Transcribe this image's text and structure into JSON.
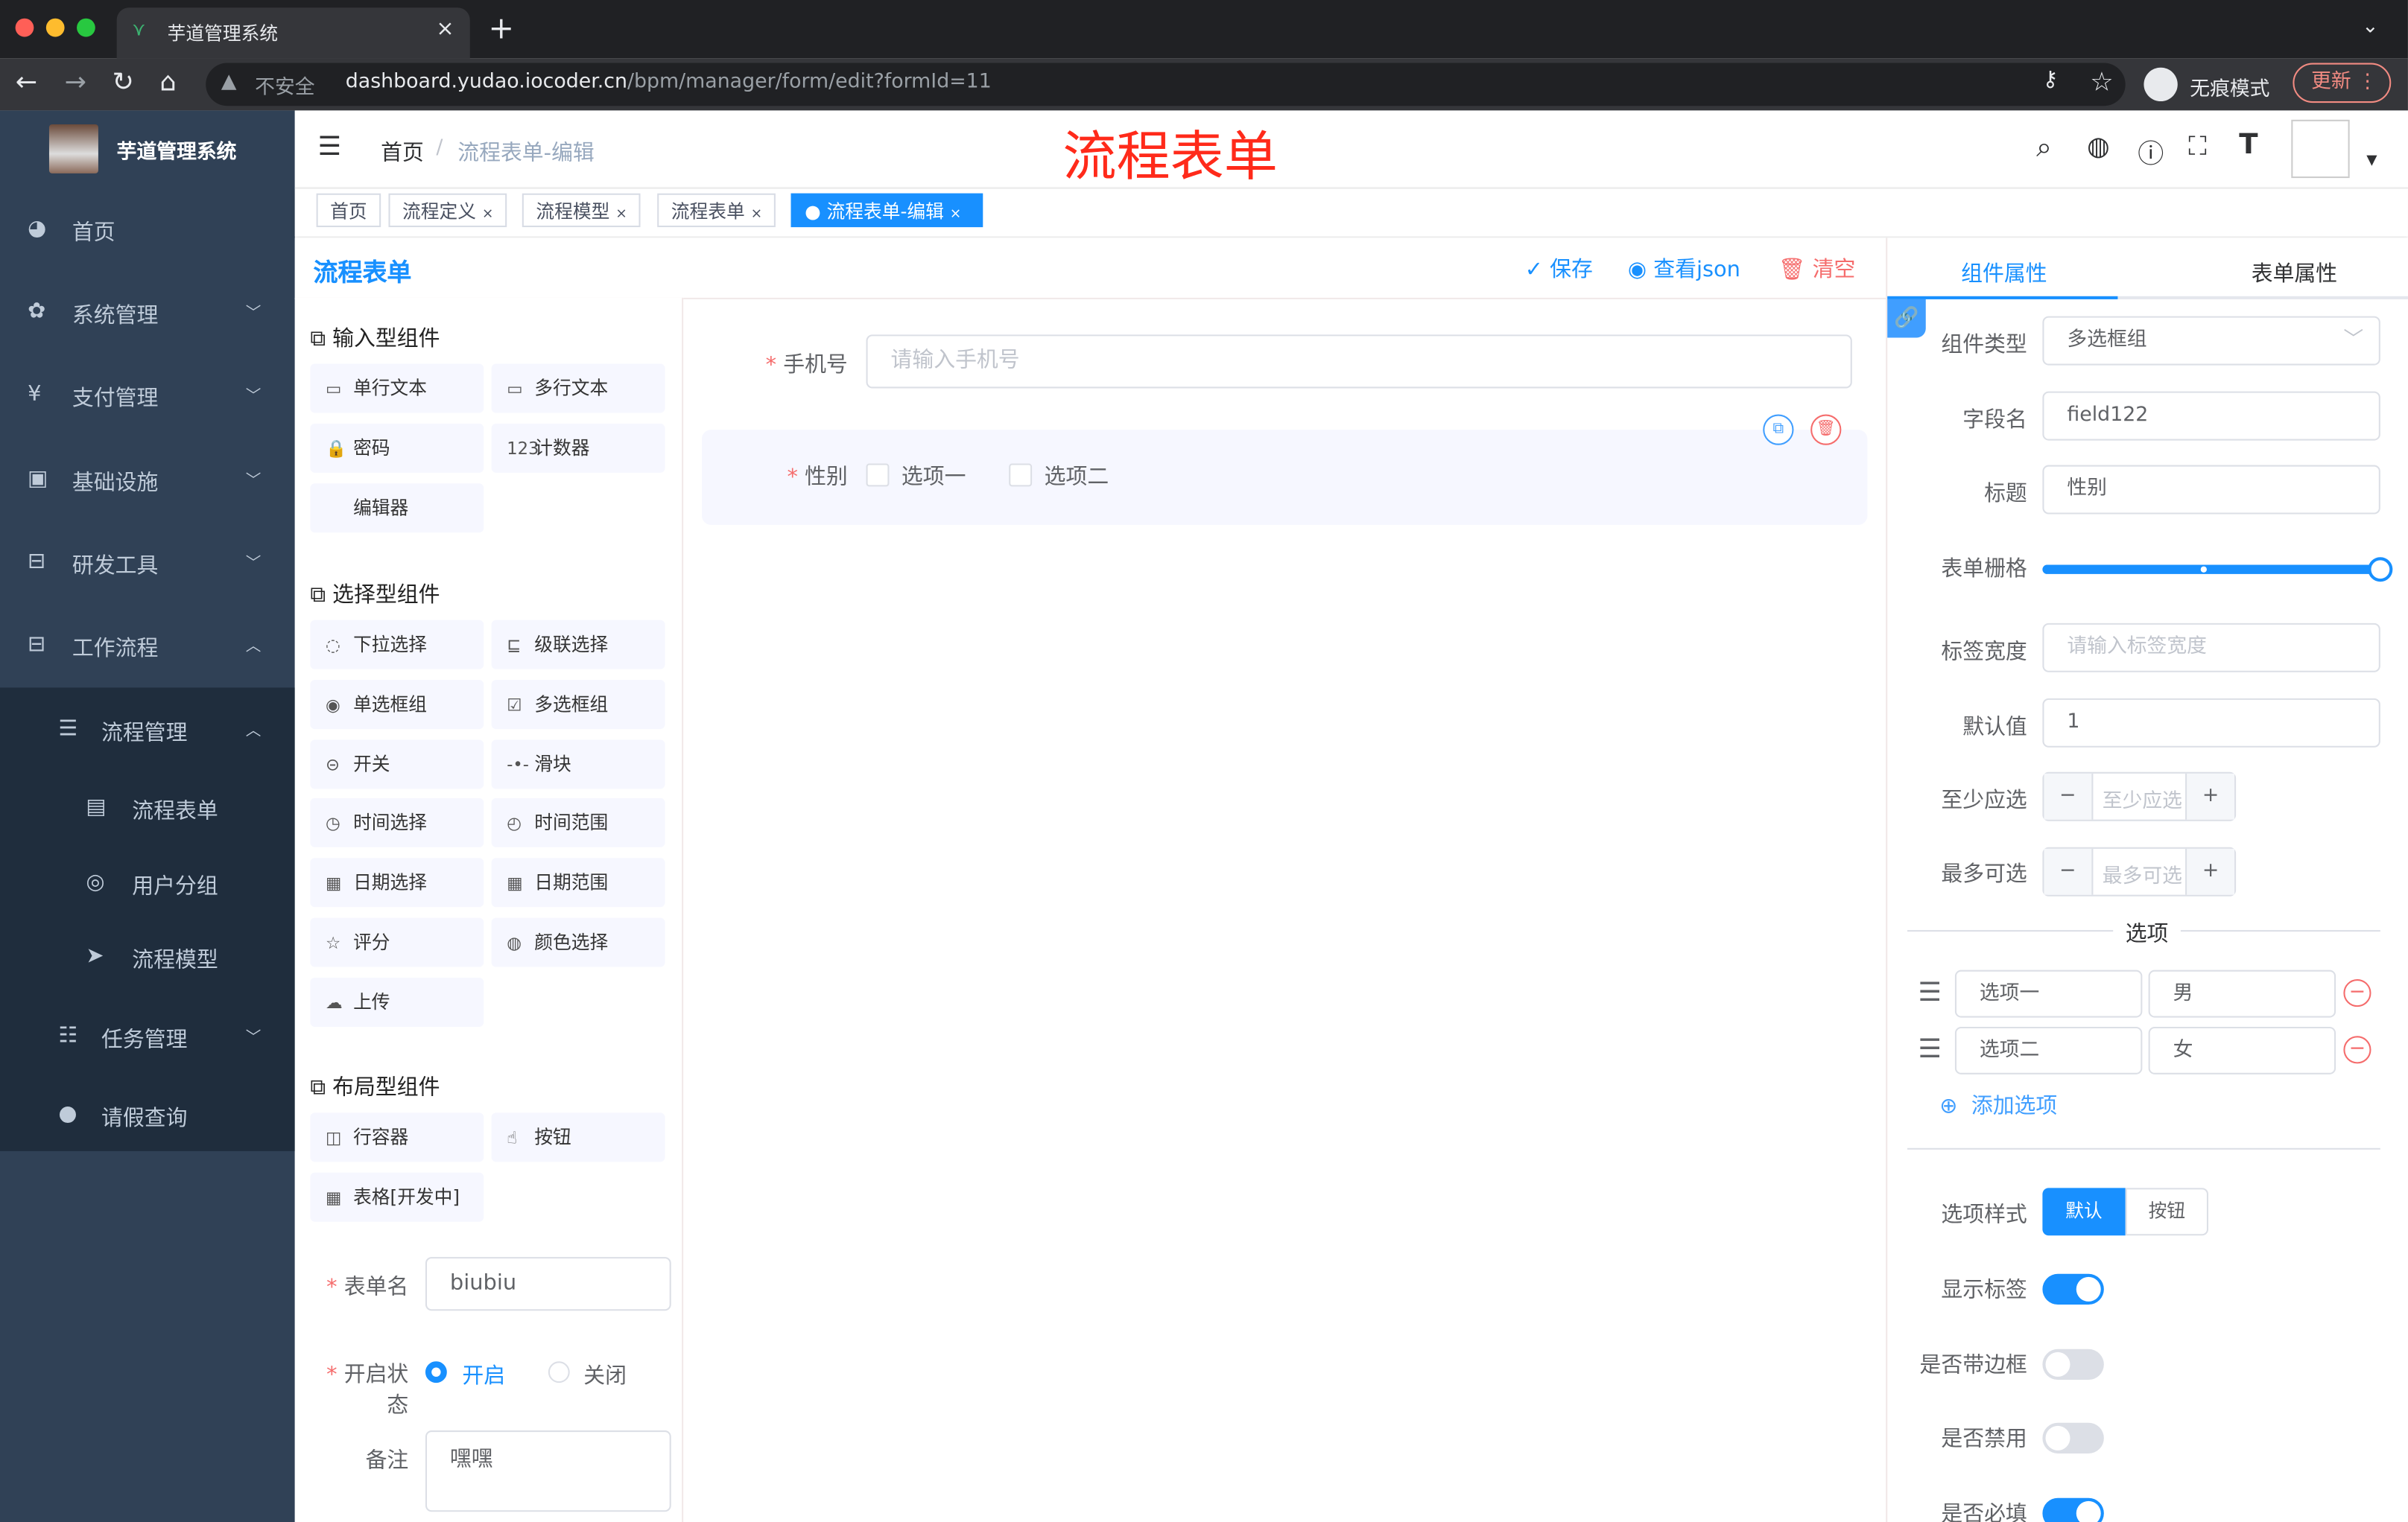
{
  "browser": {
    "tab_title": "芋道管理系统",
    "close": "×",
    "new_tab": "+",
    "insecure": "不安全",
    "url_host": "dashboard.yudao.iocoder.cn",
    "url_path": "/bpm/manager/form/edit?formId=11",
    "incognito": "无痕模式",
    "update": "更新"
  },
  "sidebar": {
    "logo_title": "芋道管理系统",
    "items": [
      {
        "label": "首页",
        "icon": "dashboard-icon"
      },
      {
        "label": "系统管理",
        "icon": "gear-icon"
      },
      {
        "label": "支付管理",
        "icon": "yen-icon"
      },
      {
        "label": "基础设施",
        "icon": "monitor-icon"
      },
      {
        "label": "研发工具",
        "icon": "toolbox-icon"
      },
      {
        "label": "工作流程",
        "icon": "toolbox-icon"
      },
      {
        "label": "流程管理",
        "icon": "tree-icon"
      },
      {
        "label": "流程表单",
        "icon": "form-icon"
      },
      {
        "label": "用户分组",
        "icon": "group-icon"
      },
      {
        "label": "流程模型",
        "icon": "send-icon"
      },
      {
        "label": "任务管理",
        "icon": "tree-icon"
      },
      {
        "label": "请假查询",
        "icon": "user-icon"
      }
    ]
  },
  "header": {
    "breadcrumb_home": "首页",
    "breadcrumb_sep": "/",
    "breadcrumb_current": "流程表单-编辑",
    "big_title": "流程表单"
  },
  "tags": [
    {
      "label": "首页"
    },
    {
      "label": "流程定义"
    },
    {
      "label": "流程模型"
    },
    {
      "label": "流程表单"
    },
    {
      "label": "流程表单-编辑",
      "active": true
    }
  ],
  "palette": {
    "title": "流程表单",
    "groups": [
      {
        "title": "输入型组件",
        "items": [
          "单行文本",
          "多行文本",
          "密码",
          "计数器",
          "编辑器"
        ]
      },
      {
        "title": "选择型组件",
        "items": [
          "下拉选择",
          "级联选择",
          "单选框组",
          "多选框组",
          "开关",
          "滑块",
          "时间选择",
          "时间范围",
          "日期选择",
          "日期范围",
          "评分",
          "颜色选择",
          "上传"
        ]
      },
      {
        "title": "布局型组件",
        "items": [
          "行容器",
          "按钮",
          "表格[开发中]"
        ]
      }
    ],
    "form_name_label": "表单名",
    "form_name": "biubiu",
    "status_label": "开启状态",
    "status_on": "开启",
    "status_off": "关闭",
    "status_value": "开启",
    "remark_label": "备注",
    "remark": "嘿嘿"
  },
  "toolbar": {
    "save": "保存",
    "view_json": "查看json",
    "clear": "清空"
  },
  "canvas": {
    "phone_label": "手机号",
    "phone_placeholder": "请输入手机号",
    "gender_label": "性别",
    "options": [
      "选项一",
      "选项二"
    ]
  },
  "props": {
    "tab_component": "组件属性",
    "tab_form": "表单属性",
    "type_label": "组件类型",
    "type_value": "多选框组",
    "field_label": "字段名",
    "field_value": "field122",
    "title_label": "标题",
    "title_value": "性别",
    "grid_label": "表单栅格",
    "grid_value_percent": 100,
    "label_width_label": "标签宽度",
    "label_width_placeholder": "请输入标签宽度",
    "default_label": "默认值",
    "default_value": "1",
    "min_label": "至少应选",
    "min_placeholder": "至少应选",
    "max_label": "最多可选",
    "max_placeholder": "最多可选",
    "minus": "−",
    "plus": "+",
    "options_divider": "选项",
    "options": [
      {
        "label": "选项一",
        "value": "男"
      },
      {
        "label": "选项二",
        "value": "女"
      }
    ],
    "add_option": "添加选项",
    "style_label": "选项样式",
    "style_default": "默认",
    "style_button": "按钮",
    "show_label": "显示标签",
    "show_label_on": true,
    "border_label": "是否带边框",
    "border_on": false,
    "disabled_label": "是否禁用",
    "disabled_on": false,
    "required_label": "是否必填",
    "required_on": true
  },
  "colors": {
    "accent": "#1890ff",
    "sidebar": "#304156",
    "submenu": "#1f2d3d",
    "danger": "#f56c6c",
    "title_red": "#ff2a1a"
  }
}
